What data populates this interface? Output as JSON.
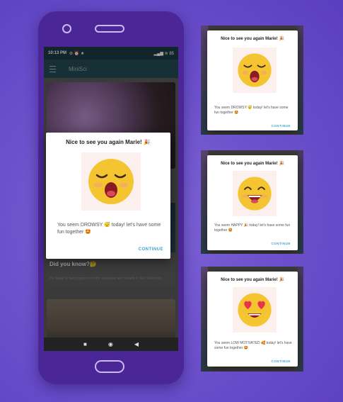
{
  "phone": {
    "status_time": "10:13 PM",
    "status_icons_left": "⊘ ⏰ ★",
    "status_icons_right": "▂▄▆ ≋ 85",
    "app_title": "MiniSci",
    "did_you_know": "Did you know?🤔",
    "fact": "It's illegal to feed pigeons on the sidewalks and streets in San Francisco.",
    "nav": {
      "square": "■",
      "circle": "◉",
      "back": "◀"
    }
  },
  "main_dialog": {
    "title": "Nice to see you again Marie! 🎉",
    "emoji": "drowsy-face-icon",
    "body": "You seem DROWSY 😴 today! let's have some fun together 🤩",
    "button": "CONTINUE"
  },
  "panels": [
    {
      "title": "Nice to see you again Marie! 🎉",
      "emoji": "drowsy-face-icon",
      "body": "You seem DROWSY 😴 today! let's have some fun together 🤩",
      "button": "CONTINUE"
    },
    {
      "title": "Nice to see you again Marie! 🎉",
      "emoji": "happy-face-icon",
      "body": "You seem HAPPY 🎉 today! let's have some fun together 🤩",
      "button": "CONTINUE"
    },
    {
      "title": "Nice to see you again Marie! 🎉",
      "emoji": "heart-eyes-face-icon",
      "body": "You seem LOW MOTIVATED 🥰 today! let's have some fun together 🤩",
      "button": "CONTINUE"
    }
  ],
  "colors": {
    "background": "#6d51cc",
    "phone_body": "#4a2696",
    "accent_button": "#3aa3d0",
    "appbar": "#244a52",
    "emoji_yellow": "#f5c531"
  }
}
